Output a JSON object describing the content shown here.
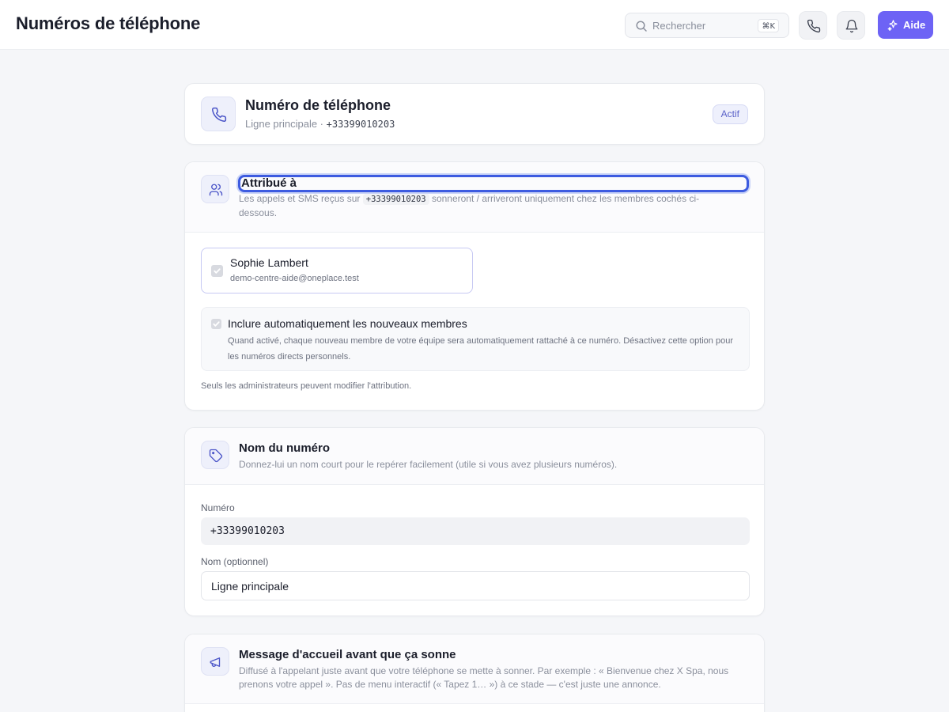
{
  "header": {
    "title": "Numéros de téléphone",
    "search_placeholder": "Rechercher",
    "search_shortcut": "⌘K",
    "help_label": "Aide",
    "icons": [
      "search-icon",
      "phone-icon",
      "bell-icon",
      "sparkles-icon"
    ]
  },
  "number_card": {
    "title": "Numéro de téléphone",
    "subtitle_label": "Ligne principale · ",
    "number": "+33399010203",
    "status": "Actif"
  },
  "assignment": {
    "title": "Attribué à",
    "desc_before": "Les appels et SMS reçus sur ",
    "desc_number": "+33399010203",
    "desc_after": " sonneront / arriveront uniquement chez les membres cochés ci-dessous.",
    "member_name": "Sophie Lambert",
    "member_email": "demo-centre-aide@oneplace.test",
    "member_checked": true,
    "auto_title": "Inclure automatiquement les nouveaux membres",
    "auto_desc": "Quand activé, chaque nouveau membre de votre équipe sera automatiquement rattaché à ce numéro. Désactivez cette option pour les numéros directs personnels.",
    "auto_checked": true,
    "admin_note": "Seuls les administrateurs peuvent modifier l'attribution."
  },
  "number_name": {
    "title": "Nom du numéro",
    "desc": "Donnez-lui un nom court pour le repérer facilement (utile si vous avez plusieurs numéros).",
    "number_label": "Numéro",
    "number_value": "+33399010203",
    "name_label": "Nom (optionnel)",
    "name_value": "Ligne principale"
  },
  "greeting": {
    "title": "Message d'accueil avant que ça sonne",
    "desc": "Diffusé à l'appelant juste avant que votre téléphone se mette à sonner. Par exemple : « Bienvenue chez X Spa, nous prenons votre appel ». Pas de menu interactif (« Tapez 1… ») à ce stade — c'est juste une annonce."
  },
  "colors": {
    "accent": "#6d63f5",
    "focus_ring": "#3d5be0",
    "badge_text": "#5a62c8",
    "page_bg": "#f5f6f9"
  }
}
